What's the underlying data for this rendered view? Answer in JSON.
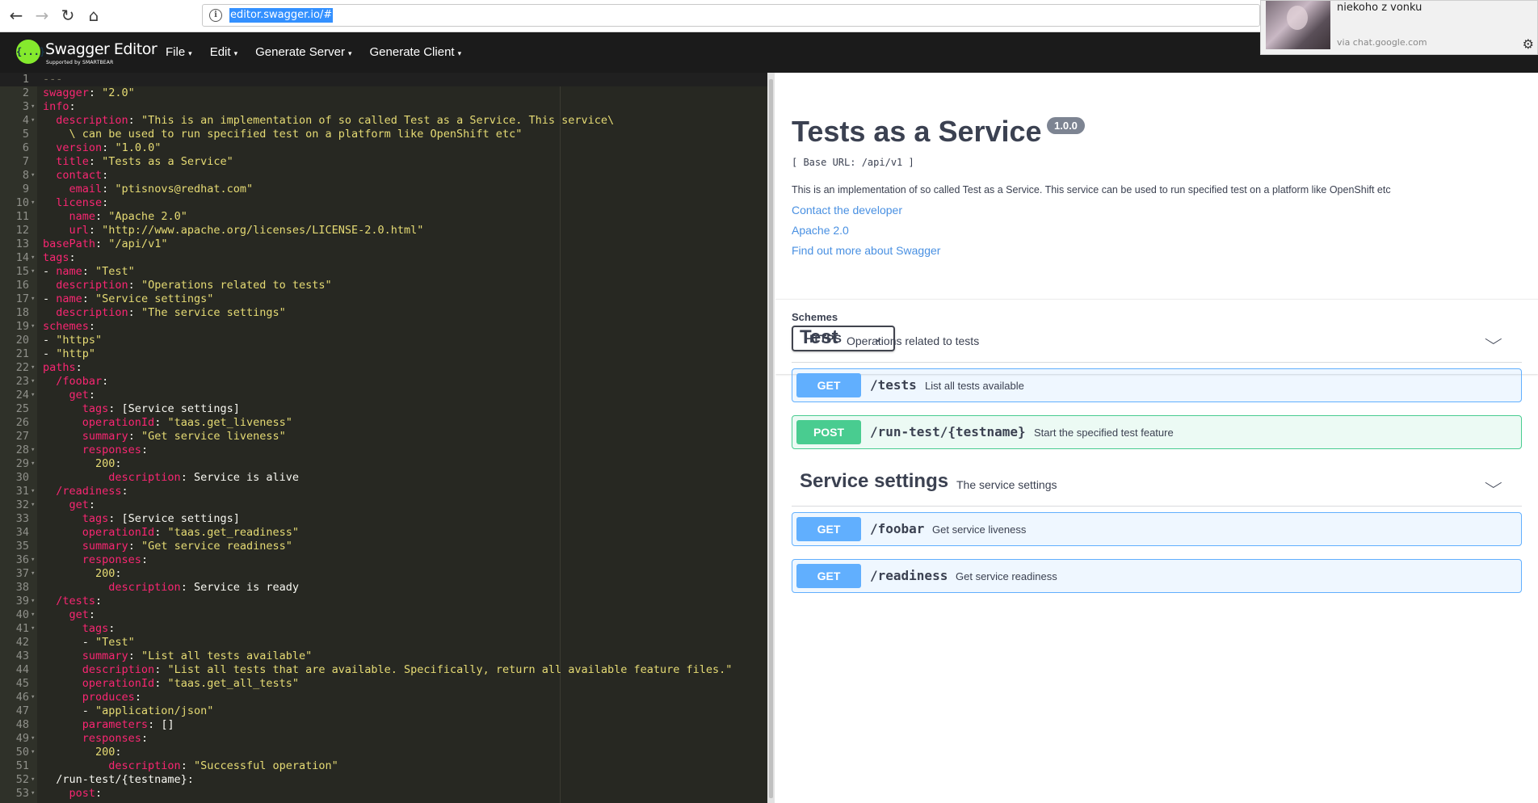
{
  "browser": {
    "url": "editor.swagger.io/#",
    "back_glyph": "←",
    "forward_glyph": "→",
    "reload_glyph": "↻",
    "home_glyph": "⌂",
    "info_glyph": "i"
  },
  "notification": {
    "text": "niekoho z vonku",
    "source": "via chat.google.com",
    "gear_glyph": "⚙"
  },
  "topbar": {
    "logo_glyph": "{...}",
    "logo_title": "Swagger Editor",
    "logo_sub": "Supported by SMARTBEAR",
    "menu": [
      {
        "label": "File"
      },
      {
        "label": "Edit"
      },
      {
        "label": "Generate Server"
      },
      {
        "label": "Generate Client"
      }
    ],
    "caret": "▾"
  },
  "editor": {
    "colors": {
      "bg": "#272822",
      "key": "#f92672",
      "string": "#e6db74",
      "plain": "#f8f8f2"
    },
    "lines": [
      {
        "n": "1",
        "fold": "",
        "tokens": [
          [
            "c",
            "---"
          ]
        ]
      },
      {
        "n": "2",
        "fold": "",
        "tokens": [
          [
            "k",
            "swagger"
          ],
          [
            "p",
            ": "
          ],
          [
            "s",
            "\"2.0\""
          ]
        ]
      },
      {
        "n": "3",
        "fold": "▾",
        "tokens": [
          [
            "k",
            "info"
          ],
          [
            "p",
            ":"
          ]
        ]
      },
      {
        "n": "4",
        "fold": "▾",
        "tokens": [
          [
            "p",
            "  "
          ],
          [
            "k",
            "description"
          ],
          [
            "p",
            ": "
          ],
          [
            "s",
            "\"This is an implementation of so called Test as a Service. This service\\"
          ]
        ]
      },
      {
        "n": "5",
        "fold": "",
        "tokens": [
          [
            "s",
            "    \\ can be used to run specified test on a platform like OpenShift etc\""
          ]
        ]
      },
      {
        "n": "6",
        "fold": "",
        "tokens": [
          [
            "p",
            "  "
          ],
          [
            "k",
            "version"
          ],
          [
            "p",
            ": "
          ],
          [
            "s",
            "\"1.0.0\""
          ]
        ]
      },
      {
        "n": "7",
        "fold": "",
        "tokens": [
          [
            "p",
            "  "
          ],
          [
            "k",
            "title"
          ],
          [
            "p",
            ": "
          ],
          [
            "s",
            "\"Tests as a Service\""
          ]
        ]
      },
      {
        "n": "8",
        "fold": "▾",
        "tokens": [
          [
            "p",
            "  "
          ],
          [
            "k",
            "contact"
          ],
          [
            "p",
            ":"
          ]
        ]
      },
      {
        "n": "9",
        "fold": "",
        "tokens": [
          [
            "p",
            "    "
          ],
          [
            "k",
            "email"
          ],
          [
            "p",
            ": "
          ],
          [
            "s",
            "\"ptisnovs@redhat.com\""
          ]
        ]
      },
      {
        "n": "10",
        "fold": "▾",
        "tokens": [
          [
            "p",
            "  "
          ],
          [
            "k",
            "license"
          ],
          [
            "p",
            ":"
          ]
        ]
      },
      {
        "n": "11",
        "fold": "",
        "tokens": [
          [
            "p",
            "    "
          ],
          [
            "k",
            "name"
          ],
          [
            "p",
            ": "
          ],
          [
            "s",
            "\"Apache 2.0\""
          ]
        ]
      },
      {
        "n": "12",
        "fold": "",
        "tokens": [
          [
            "p",
            "    "
          ],
          [
            "k",
            "url"
          ],
          [
            "p",
            ": "
          ],
          [
            "s",
            "\"http://www.apache.org/licenses/LICENSE-2.0.html\""
          ]
        ]
      },
      {
        "n": "13",
        "fold": "",
        "tokens": [
          [
            "k",
            "basePath"
          ],
          [
            "p",
            ": "
          ],
          [
            "s",
            "\"/api/v1\""
          ]
        ]
      },
      {
        "n": "14",
        "fold": "▾",
        "tokens": [
          [
            "k",
            "tags"
          ],
          [
            "p",
            ":"
          ]
        ]
      },
      {
        "n": "15",
        "fold": "▾",
        "tokens": [
          [
            "p",
            "- "
          ],
          [
            "k",
            "name"
          ],
          [
            "p",
            ": "
          ],
          [
            "s",
            "\"Test\""
          ]
        ]
      },
      {
        "n": "16",
        "fold": "",
        "tokens": [
          [
            "p",
            "  "
          ],
          [
            "k",
            "description"
          ],
          [
            "p",
            ": "
          ],
          [
            "s",
            "\"Operations related to tests\""
          ]
        ]
      },
      {
        "n": "17",
        "fold": "▾",
        "tokens": [
          [
            "p",
            "- "
          ],
          [
            "k",
            "name"
          ],
          [
            "p",
            ": "
          ],
          [
            "s",
            "\"Service settings\""
          ]
        ]
      },
      {
        "n": "18",
        "fold": "",
        "tokens": [
          [
            "p",
            "  "
          ],
          [
            "k",
            "description"
          ],
          [
            "p",
            ": "
          ],
          [
            "s",
            "\"The service settings\""
          ]
        ]
      },
      {
        "n": "19",
        "fold": "▾",
        "tokens": [
          [
            "k",
            "schemes"
          ],
          [
            "p",
            ":"
          ]
        ]
      },
      {
        "n": "20",
        "fold": "",
        "tokens": [
          [
            "p",
            "- "
          ],
          [
            "s",
            "\"https\""
          ]
        ]
      },
      {
        "n": "21",
        "fold": "",
        "tokens": [
          [
            "p",
            "- "
          ],
          [
            "s",
            "\"http\""
          ]
        ]
      },
      {
        "n": "22",
        "fold": "▾",
        "tokens": [
          [
            "k",
            "paths"
          ],
          [
            "p",
            ":"
          ]
        ]
      },
      {
        "n": "23",
        "fold": "▾",
        "tokens": [
          [
            "p",
            "  "
          ],
          [
            "k",
            "/foobar"
          ],
          [
            "p",
            ":"
          ]
        ]
      },
      {
        "n": "24",
        "fold": "▾",
        "tokens": [
          [
            "p",
            "    "
          ],
          [
            "k",
            "get"
          ],
          [
            "p",
            ":"
          ]
        ]
      },
      {
        "n": "25",
        "fold": "",
        "tokens": [
          [
            "p",
            "      "
          ],
          [
            "k",
            "tags"
          ],
          [
            "p",
            ": [Service settings]"
          ]
        ]
      },
      {
        "n": "26",
        "fold": "",
        "tokens": [
          [
            "p",
            "      "
          ],
          [
            "k",
            "operationId"
          ],
          [
            "p",
            ": "
          ],
          [
            "s",
            "\"taas.get_liveness\""
          ]
        ]
      },
      {
        "n": "27",
        "fold": "",
        "tokens": [
          [
            "p",
            "      "
          ],
          [
            "k",
            "summary"
          ],
          [
            "p",
            ": "
          ],
          [
            "s",
            "\"Get service liveness\""
          ]
        ]
      },
      {
        "n": "28",
        "fold": "▾",
        "tokens": [
          [
            "p",
            "      "
          ],
          [
            "k",
            "responses"
          ],
          [
            "p",
            ":"
          ]
        ]
      },
      {
        "n": "29",
        "fold": "▾",
        "tokens": [
          [
            "p",
            "        "
          ],
          [
            "s",
            "200"
          ],
          [
            "p",
            ":"
          ]
        ]
      },
      {
        "n": "30",
        "fold": "",
        "tokens": [
          [
            "p",
            "          "
          ],
          [
            "k",
            "description"
          ],
          [
            "p",
            ": Service is alive"
          ]
        ]
      },
      {
        "n": "31",
        "fold": "▾",
        "tokens": [
          [
            "p",
            "  "
          ],
          [
            "k",
            "/readiness"
          ],
          [
            "p",
            ":"
          ]
        ]
      },
      {
        "n": "32",
        "fold": "▾",
        "tokens": [
          [
            "p",
            "    "
          ],
          [
            "k",
            "get"
          ],
          [
            "p",
            ":"
          ]
        ]
      },
      {
        "n": "33",
        "fold": "",
        "tokens": [
          [
            "p",
            "      "
          ],
          [
            "k",
            "tags"
          ],
          [
            "p",
            ": [Service settings]"
          ]
        ]
      },
      {
        "n": "34",
        "fold": "",
        "tokens": [
          [
            "p",
            "      "
          ],
          [
            "k",
            "operationId"
          ],
          [
            "p",
            ": "
          ],
          [
            "s",
            "\"taas.get_readiness\""
          ]
        ]
      },
      {
        "n": "35",
        "fold": "",
        "tokens": [
          [
            "p",
            "      "
          ],
          [
            "k",
            "summary"
          ],
          [
            "p",
            ": "
          ],
          [
            "s",
            "\"Get service readiness\""
          ]
        ]
      },
      {
        "n": "36",
        "fold": "▾",
        "tokens": [
          [
            "p",
            "      "
          ],
          [
            "k",
            "responses"
          ],
          [
            "p",
            ":"
          ]
        ]
      },
      {
        "n": "37",
        "fold": "▾",
        "tokens": [
          [
            "p",
            "        "
          ],
          [
            "s",
            "200"
          ],
          [
            "p",
            ":"
          ]
        ]
      },
      {
        "n": "38",
        "fold": "",
        "tokens": [
          [
            "p",
            "          "
          ],
          [
            "k",
            "description"
          ],
          [
            "p",
            ": Service is ready"
          ]
        ]
      },
      {
        "n": "39",
        "fold": "▾",
        "tokens": [
          [
            "p",
            "  "
          ],
          [
            "k",
            "/tests"
          ],
          [
            "p",
            ":"
          ]
        ]
      },
      {
        "n": "40",
        "fold": "▾",
        "tokens": [
          [
            "p",
            "    "
          ],
          [
            "k",
            "get"
          ],
          [
            "p",
            ":"
          ]
        ]
      },
      {
        "n": "41",
        "fold": "▾",
        "tokens": [
          [
            "p",
            "      "
          ],
          [
            "k",
            "tags"
          ],
          [
            "p",
            ":"
          ]
        ]
      },
      {
        "n": "42",
        "fold": "",
        "tokens": [
          [
            "p",
            "      - "
          ],
          [
            "s",
            "\"Test\""
          ]
        ]
      },
      {
        "n": "43",
        "fold": "",
        "tokens": [
          [
            "p",
            "      "
          ],
          [
            "k",
            "summary"
          ],
          [
            "p",
            ": "
          ],
          [
            "s",
            "\"List all tests available\""
          ]
        ]
      },
      {
        "n": "44",
        "fold": "",
        "tokens": [
          [
            "p",
            "      "
          ],
          [
            "k",
            "description"
          ],
          [
            "p",
            ": "
          ],
          [
            "s",
            "\"List all tests that are available. Specifically, return all available feature files.\""
          ]
        ]
      },
      {
        "n": "45",
        "fold": "",
        "tokens": [
          [
            "p",
            "      "
          ],
          [
            "k",
            "operationId"
          ],
          [
            "p",
            ": "
          ],
          [
            "s",
            "\"taas.get_all_tests\""
          ]
        ]
      },
      {
        "n": "46",
        "fold": "▾",
        "tokens": [
          [
            "p",
            "      "
          ],
          [
            "k",
            "produces"
          ],
          [
            "p",
            ":"
          ]
        ]
      },
      {
        "n": "47",
        "fold": "",
        "tokens": [
          [
            "p",
            "      - "
          ],
          [
            "s",
            "\"application/json\""
          ]
        ]
      },
      {
        "n": "48",
        "fold": "",
        "tokens": [
          [
            "p",
            "      "
          ],
          [
            "k",
            "parameters"
          ],
          [
            "p",
            ": []"
          ]
        ]
      },
      {
        "n": "49",
        "fold": "▾",
        "tokens": [
          [
            "p",
            "      "
          ],
          [
            "k",
            "responses"
          ],
          [
            "p",
            ":"
          ]
        ]
      },
      {
        "n": "50",
        "fold": "▾",
        "tokens": [
          [
            "p",
            "        "
          ],
          [
            "s",
            "200"
          ],
          [
            "p",
            ":"
          ]
        ]
      },
      {
        "n": "51",
        "fold": "",
        "tokens": [
          [
            "p",
            "          "
          ],
          [
            "k",
            "description"
          ],
          [
            "p",
            ": "
          ],
          [
            "s",
            "\"Successful operation\""
          ]
        ]
      },
      {
        "n": "52",
        "fold": "▾",
        "tokens": [
          [
            "p",
            "  /run-test/{testname}:"
          ]
        ]
      },
      {
        "n": "53",
        "fold": "▾",
        "tokens": [
          [
            "p",
            "    "
          ],
          [
            "k",
            "post"
          ],
          [
            "p",
            ":"
          ]
        ]
      }
    ]
  },
  "info": {
    "title": "Tests as a Service",
    "version": "1.0.0",
    "base_url": "[ Base URL: /api/v1 ]",
    "description": "This is an implementation of so called Test as a Service. This service can be used to run specified test on a platform like OpenShift etc",
    "contact_link": "Contact the developer",
    "license_link": "Apache 2.0",
    "swagger_link": "Find out more about Swagger"
  },
  "schemes": {
    "label": "Schemes",
    "selected": "HTTPS",
    "chevron": "⌄"
  },
  "tags": [
    {
      "name": "Test",
      "description": "Operations related to tests",
      "chevron": "⌵",
      "operations": [
        {
          "method": "GET",
          "path": "/tests",
          "summary": "List all tests available"
        },
        {
          "method": "POST",
          "path": "/run-test/{testname}",
          "summary": "Start the specified test feature"
        }
      ]
    },
    {
      "name": "Service settings",
      "description": "The service settings",
      "chevron": "⌵",
      "operations": [
        {
          "method": "GET",
          "path": "/foobar",
          "summary": "Get service liveness"
        },
        {
          "method": "GET",
          "path": "/readiness",
          "summary": "Get service readiness"
        }
      ]
    }
  ],
  "accent_colors": {
    "get": "#61affe",
    "post": "#49cc90",
    "link": "#4990e2",
    "swagger_green": "#85ea2d"
  }
}
